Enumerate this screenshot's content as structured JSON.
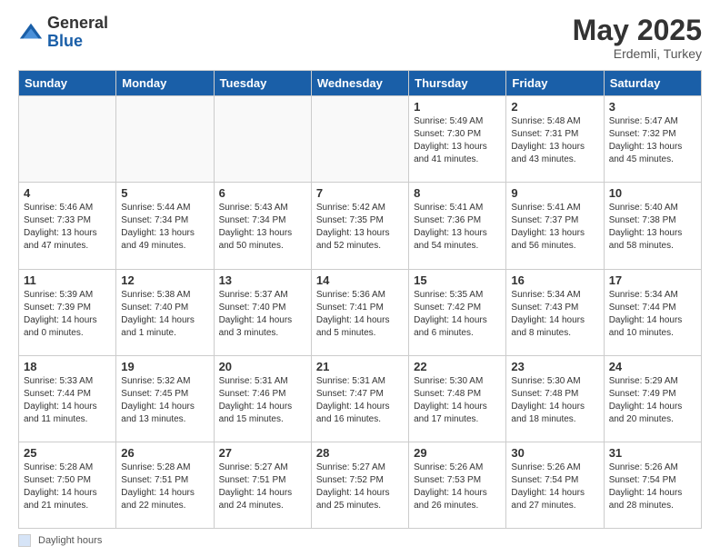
{
  "header": {
    "logo_general": "General",
    "logo_blue": "Blue",
    "month": "May 2025",
    "location": "Erdemli, Turkey"
  },
  "weekdays": [
    "Sunday",
    "Monday",
    "Tuesday",
    "Wednesday",
    "Thursday",
    "Friday",
    "Saturday"
  ],
  "footer": {
    "label": "Daylight hours"
  },
  "weeks": [
    [
      {
        "day": "",
        "info": ""
      },
      {
        "day": "",
        "info": ""
      },
      {
        "day": "",
        "info": ""
      },
      {
        "day": "",
        "info": ""
      },
      {
        "day": "1",
        "info": "Sunrise: 5:49 AM\nSunset: 7:30 PM\nDaylight: 13 hours\nand 41 minutes."
      },
      {
        "day": "2",
        "info": "Sunrise: 5:48 AM\nSunset: 7:31 PM\nDaylight: 13 hours\nand 43 minutes."
      },
      {
        "day": "3",
        "info": "Sunrise: 5:47 AM\nSunset: 7:32 PM\nDaylight: 13 hours\nand 45 minutes."
      }
    ],
    [
      {
        "day": "4",
        "info": "Sunrise: 5:46 AM\nSunset: 7:33 PM\nDaylight: 13 hours\nand 47 minutes."
      },
      {
        "day": "5",
        "info": "Sunrise: 5:44 AM\nSunset: 7:34 PM\nDaylight: 13 hours\nand 49 minutes."
      },
      {
        "day": "6",
        "info": "Sunrise: 5:43 AM\nSunset: 7:34 PM\nDaylight: 13 hours\nand 50 minutes."
      },
      {
        "day": "7",
        "info": "Sunrise: 5:42 AM\nSunset: 7:35 PM\nDaylight: 13 hours\nand 52 minutes."
      },
      {
        "day": "8",
        "info": "Sunrise: 5:41 AM\nSunset: 7:36 PM\nDaylight: 13 hours\nand 54 minutes."
      },
      {
        "day": "9",
        "info": "Sunrise: 5:41 AM\nSunset: 7:37 PM\nDaylight: 13 hours\nand 56 minutes."
      },
      {
        "day": "10",
        "info": "Sunrise: 5:40 AM\nSunset: 7:38 PM\nDaylight: 13 hours\nand 58 minutes."
      }
    ],
    [
      {
        "day": "11",
        "info": "Sunrise: 5:39 AM\nSunset: 7:39 PM\nDaylight: 14 hours\nand 0 minutes."
      },
      {
        "day": "12",
        "info": "Sunrise: 5:38 AM\nSunset: 7:40 PM\nDaylight: 14 hours\nand 1 minute."
      },
      {
        "day": "13",
        "info": "Sunrise: 5:37 AM\nSunset: 7:40 PM\nDaylight: 14 hours\nand 3 minutes."
      },
      {
        "day": "14",
        "info": "Sunrise: 5:36 AM\nSunset: 7:41 PM\nDaylight: 14 hours\nand 5 minutes."
      },
      {
        "day": "15",
        "info": "Sunrise: 5:35 AM\nSunset: 7:42 PM\nDaylight: 14 hours\nand 6 minutes."
      },
      {
        "day": "16",
        "info": "Sunrise: 5:34 AM\nSunset: 7:43 PM\nDaylight: 14 hours\nand 8 minutes."
      },
      {
        "day": "17",
        "info": "Sunrise: 5:34 AM\nSunset: 7:44 PM\nDaylight: 14 hours\nand 10 minutes."
      }
    ],
    [
      {
        "day": "18",
        "info": "Sunrise: 5:33 AM\nSunset: 7:44 PM\nDaylight: 14 hours\nand 11 minutes."
      },
      {
        "day": "19",
        "info": "Sunrise: 5:32 AM\nSunset: 7:45 PM\nDaylight: 14 hours\nand 13 minutes."
      },
      {
        "day": "20",
        "info": "Sunrise: 5:31 AM\nSunset: 7:46 PM\nDaylight: 14 hours\nand 15 minutes."
      },
      {
        "day": "21",
        "info": "Sunrise: 5:31 AM\nSunset: 7:47 PM\nDaylight: 14 hours\nand 16 minutes."
      },
      {
        "day": "22",
        "info": "Sunrise: 5:30 AM\nSunset: 7:48 PM\nDaylight: 14 hours\nand 17 minutes."
      },
      {
        "day": "23",
        "info": "Sunrise: 5:30 AM\nSunset: 7:48 PM\nDaylight: 14 hours\nand 18 minutes."
      },
      {
        "day": "24",
        "info": "Sunrise: 5:29 AM\nSunset: 7:49 PM\nDaylight: 14 hours\nand 20 minutes."
      }
    ],
    [
      {
        "day": "25",
        "info": "Sunrise: 5:28 AM\nSunset: 7:50 PM\nDaylight: 14 hours\nand 21 minutes."
      },
      {
        "day": "26",
        "info": "Sunrise: 5:28 AM\nSunset: 7:51 PM\nDaylight: 14 hours\nand 22 minutes."
      },
      {
        "day": "27",
        "info": "Sunrise: 5:27 AM\nSunset: 7:51 PM\nDaylight: 14 hours\nand 24 minutes."
      },
      {
        "day": "28",
        "info": "Sunrise: 5:27 AM\nSunset: 7:52 PM\nDaylight: 14 hours\nand 25 minutes."
      },
      {
        "day": "29",
        "info": "Sunrise: 5:26 AM\nSunset: 7:53 PM\nDaylight: 14 hours\nand 26 minutes."
      },
      {
        "day": "30",
        "info": "Sunrise: 5:26 AM\nSunset: 7:54 PM\nDaylight: 14 hours\nand 27 minutes."
      },
      {
        "day": "31",
        "info": "Sunrise: 5:26 AM\nSunset: 7:54 PM\nDaylight: 14 hours\nand 28 minutes."
      }
    ]
  ]
}
